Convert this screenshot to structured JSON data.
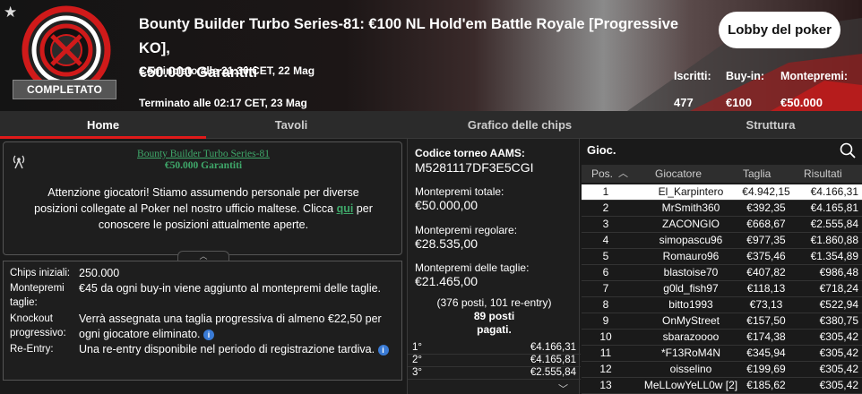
{
  "header": {
    "title_line1": "Bounty Builder Turbo Series-81: €100 NL Hold'em Battle Royale [Progressive KO],",
    "title_line2": "€50.000 Garantiti",
    "started": "Cominciato alle 21:30 CET, 22 Mag",
    "ended": "Terminato alle 02:17 CET, 23 Mag",
    "status": "COMPLETATO",
    "lobby_button": "Lobby del poker",
    "stats": [
      {
        "label": "Iscritti:",
        "value": "477"
      },
      {
        "label": "Buy-in:",
        "value": "€100"
      },
      {
        "label": "Montepremi:",
        "value": "€50.000"
      }
    ],
    "star_icon": "★"
  },
  "tabs": [
    {
      "label": "Home",
      "active": true
    },
    {
      "label": "Tavoli",
      "active": false
    },
    {
      "label": "Grafico delle chips",
      "active": false
    },
    {
      "label": "Struttura",
      "active": false
    }
  ],
  "info_box": {
    "tournament_name": "Bounty Builder Turbo Series-81",
    "guarantee": "€50.000 Garantiti",
    "message_part1": "Attenzione giocatori! Stiamo assumendo personale per diverse posizioni collegate al Poker nel nostro ufficio maltese. Clicca ",
    "message_link": "qui",
    "message_part2": " per conoscere le posizioni attualmente aperte."
  },
  "details": {
    "chips_label": "Chips iniziali:",
    "chips_value": "250.000",
    "bounty_label": "Montepremi taglie:",
    "bounty_value": "€45 da ogni buy-in viene aggiunto al montepremi delle taglie.",
    "ko_label": "Knockout progressivo:",
    "ko_value": "Verrà assegnata una taglia progressiva di almeno €22,50 per ogni giocatore eliminato.",
    "reentry_label": "Re-Entry:",
    "reentry_value": "Una re-entry disponibile nel periodo di registrazione tardiva."
  },
  "middle": {
    "aams_label": "Codice torneo AAMS:",
    "aams_value": "M5281117DF3E5CGI",
    "total_label": "Montepremi totale:",
    "total_value": "€50.000,00",
    "regular_label": "Montepremi regolare:",
    "regular_value": "€28.535,00",
    "bounty_label": "Montepremi delle taglie:",
    "bounty_value": "€21.465,00",
    "summary_line1": "(376 posti, 101 re-entry)",
    "summary_line2": "89 posti",
    "summary_line3": "pagati.",
    "places": [
      {
        "pos": "1°",
        "value": "€4.166,31"
      },
      {
        "pos": "2°",
        "value": "€4.165,81"
      },
      {
        "pos": "3°",
        "value": "€2.555,84"
      }
    ]
  },
  "players": {
    "title": "Gioc.",
    "columns": [
      "Pos.",
      "Giocatore",
      "Taglia",
      "Risultati"
    ],
    "rows": [
      {
        "pos": "1",
        "name": "El_Karpintero",
        "bounty": "€4.942,15",
        "result": "€4.166,31"
      },
      {
        "pos": "2",
        "name": "MrSmith360",
        "bounty": "€392,35",
        "result": "€4.165,81"
      },
      {
        "pos": "3",
        "name": "ZACONGIO",
        "bounty": "€668,67",
        "result": "€2.555,84"
      },
      {
        "pos": "4",
        "name": "simopascu96",
        "bounty": "€977,35",
        "result": "€1.860,88"
      },
      {
        "pos": "5",
        "name": "Romauro96",
        "bounty": "€375,46",
        "result": "€1.354,89"
      },
      {
        "pos": "6",
        "name": "blastoise70",
        "bounty": "€407,82",
        "result": "€986,48"
      },
      {
        "pos": "7",
        "name": "g0ld_fish97",
        "bounty": "€118,13",
        "result": "€718,24"
      },
      {
        "pos": "8",
        "name": "bitto1993",
        "bounty": "€73,13",
        "result": "€522,94"
      },
      {
        "pos": "9",
        "name": "OnMyStreet",
        "bounty": "€157,50",
        "result": "€380,75"
      },
      {
        "pos": "10",
        "name": "sbarazoooo",
        "bounty": "€174,38",
        "result": "€305,42"
      },
      {
        "pos": "11",
        "name": "*F13RoM4N",
        "bounty": "€345,94",
        "result": "€305,42"
      },
      {
        "pos": "12",
        "name": "oisselino",
        "bounty": "€199,69",
        "result": "€305,42"
      },
      {
        "pos": "13",
        "name": "MeLLowYeLL0w [2]",
        "bounty": "€185,62",
        "result": "€305,42"
      }
    ]
  }
}
